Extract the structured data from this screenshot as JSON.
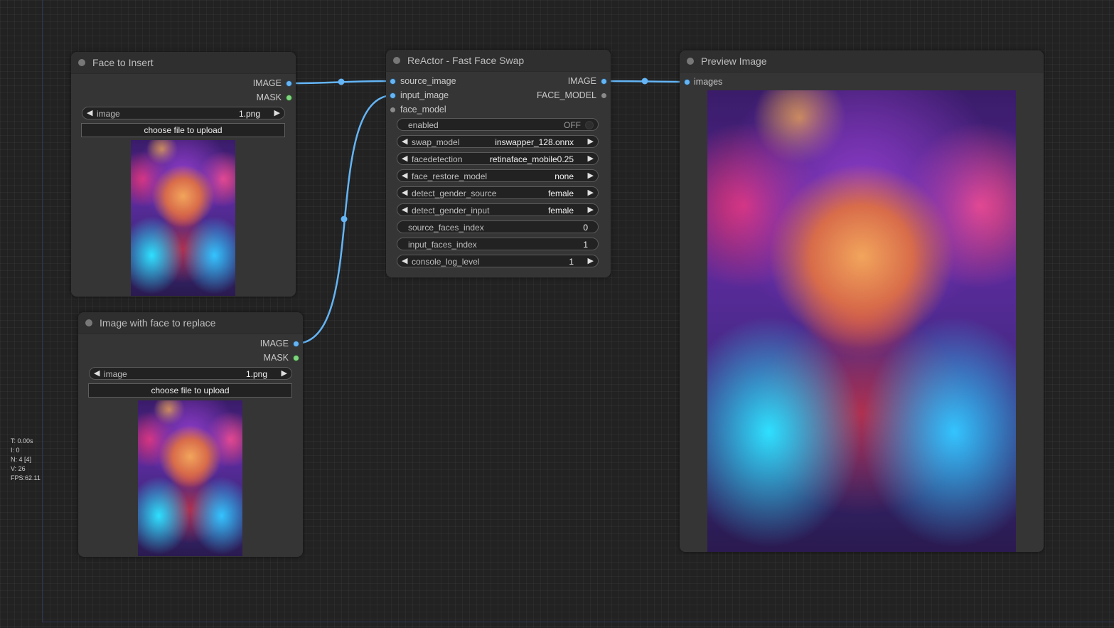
{
  "stats": {
    "t": "T: 0.00s",
    "i": "I: 0",
    "n": "N: 4 [4]",
    "v": "V: 26",
    "fps": "FPS:62.11"
  },
  "colors": {
    "link": "#64b5f6",
    "image_slot": "#64b5f6",
    "mask_slot": "#7ed67e",
    "canvas_bg": "#222222",
    "node_bg": "#353535"
  },
  "nodes": {
    "face_to_insert": {
      "title": "Face to Insert",
      "outputs": [
        "IMAGE",
        "MASK"
      ],
      "image_widget": {
        "label": "image",
        "value": "1.png"
      },
      "upload_label": "choose file to upload"
    },
    "image_with_face": {
      "title": "Image with face to replace",
      "outputs": [
        "IMAGE",
        "MASK"
      ],
      "image_widget": {
        "label": "image",
        "value": "1.png"
      },
      "upload_label": "choose file to upload"
    },
    "reactor": {
      "title": "ReActor - Fast Face Swap",
      "inputs": [
        "source_image",
        "input_image",
        "face_model"
      ],
      "outputs": [
        "IMAGE",
        "FACE_MODEL"
      ],
      "enabled": {
        "label": "enabled",
        "value": "OFF"
      },
      "widgets": [
        {
          "label": "swap_model",
          "value": "inswapper_128.onnx"
        },
        {
          "label": "facedetection",
          "value": "retinaface_mobile0.25"
        },
        {
          "label": "face_restore_model",
          "value": "none"
        },
        {
          "label": "detect_gender_source",
          "value": "female"
        },
        {
          "label": "detect_gender_input",
          "value": "female"
        },
        {
          "label": "source_faces_index",
          "value": "0"
        },
        {
          "label": "input_faces_index",
          "value": "1"
        },
        {
          "label": "console_log_level",
          "value": "1"
        }
      ]
    },
    "preview": {
      "title": "Preview Image",
      "inputs": [
        "images"
      ]
    }
  }
}
